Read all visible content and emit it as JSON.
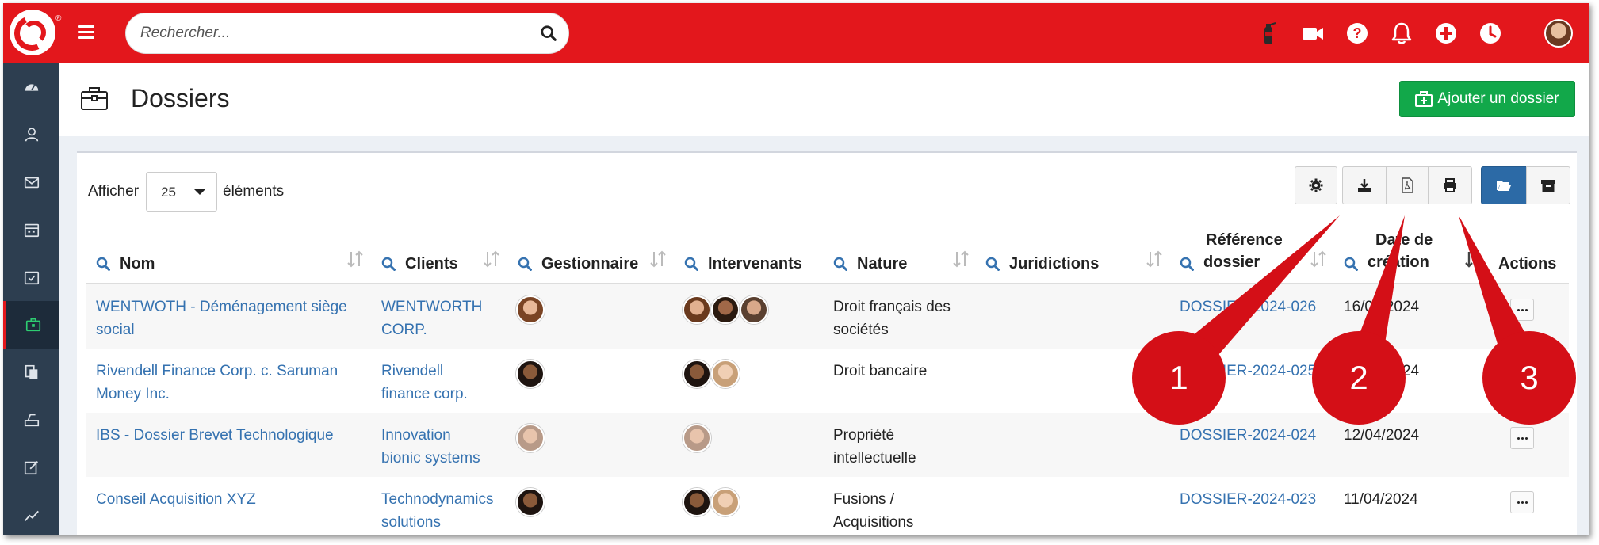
{
  "topbar": {
    "search_placeholder": "Rechercher...",
    "icons": [
      "fire-extinguisher-icon",
      "video-icon",
      "help-icon",
      "bell-icon",
      "plus-circle-icon",
      "clock-icon"
    ]
  },
  "sidebar": {
    "items": [
      "dashboard-icon",
      "contacts-icon",
      "mail-icon",
      "calendar-icon",
      "tasks-icon",
      "dossiers-icon",
      "documents-icon",
      "billing-icon",
      "notes-icon",
      "reports-icon"
    ],
    "active_index": 5
  },
  "page": {
    "title": "Dossiers",
    "add_button": "Ajouter un dossier"
  },
  "table_controls": {
    "show_label": "Afficher",
    "page_size": "25",
    "show_after": "éléments"
  },
  "table": {
    "headers": {
      "nom": "Nom",
      "clients": "Clients",
      "gestionnaire": "Gestionnaire",
      "intervenants": "Intervenants",
      "nature": "Nature",
      "juridictions": "Juridictions",
      "reference_l1": "Référence",
      "reference_l2": "dossier",
      "date_l1": "Date de",
      "date_l2": "création",
      "actions": "Actions"
    },
    "rows": [
      {
        "nom_l1": "WENTWOTH - Déménagement siège",
        "nom_l2": "social",
        "client_l1": "WENTWORTH",
        "client_l2": "CORP.",
        "nature_l1": "Droit français des",
        "nature_l2": "sociétés",
        "reference": "DOSSIER-2024-026",
        "date": "16/04/2024"
      },
      {
        "nom_l1": "Rivendell Finance Corp. c. Saruman",
        "nom_l2": "Money Inc.",
        "client_l1": "Rivendell",
        "client_l2": "finance corp.",
        "nature_l1": "Droit bancaire",
        "nature_l2": "",
        "reference": "DOSSIER-2024-025",
        "date": "15/04/2024"
      },
      {
        "nom_l1": "IBS - Dossier Brevet Technologique",
        "nom_l2": "",
        "client_l1": "Innovation",
        "client_l2": "bionic systems",
        "nature_l1": "Propriété",
        "nature_l2": "intellectuelle",
        "reference": "DOSSIER-2024-024",
        "date": "12/04/2024"
      },
      {
        "nom_l1": "Conseil Acquisition XYZ",
        "nom_l2": "",
        "client_l1": "Technodynamics",
        "client_l2": "solutions",
        "nature_l1": "Fusions /",
        "nature_l2": "Acquisitions",
        "reference": "DOSSIER-2024-023",
        "date": "11/04/2024"
      }
    ]
  },
  "callouts": [
    "1",
    "2",
    "3"
  ],
  "colors": {
    "brand_red": "#e3171c",
    "sidebar": "#2d3e50",
    "link": "#3572b0",
    "add_green": "#12a84a",
    "toggle_blue": "#2c6aa6",
    "callout_red": "#d40f17"
  }
}
